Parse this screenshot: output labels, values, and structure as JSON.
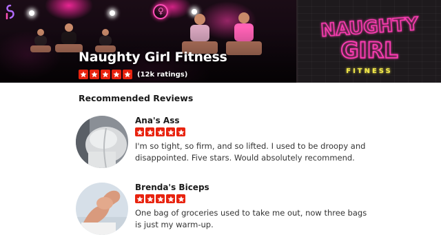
{
  "business": {
    "name": "Naughty Girl Fitness",
    "rating": 5,
    "ratings_count": "(12k ratings)"
  },
  "neon_sign": {
    "line1": "NAUGHTY",
    "line2": "GIRL",
    "line3": "FITNESS"
  },
  "reviews_section": {
    "title": "Recommended Reviews"
  },
  "reviews": [
    {
      "author": "Ana's Ass",
      "rating": 5,
      "text": "I'm so tight, so firm, and so lifted. I used to be droopy and disappointed. Five stars. Would absolutely recommend."
    },
    {
      "author": "Brenda's Biceps",
      "rating": 5,
      "text": "One bag of groceries used to take me out, now three bags is just my warm-up."
    }
  ],
  "colors": {
    "star_red": "#e8230f",
    "neon_pink": "#ff3db4",
    "neon_yellow": "#f2e84a"
  },
  "icons": [
    "star-icon",
    "app-logo-icon",
    "studio-logo-icon"
  ]
}
